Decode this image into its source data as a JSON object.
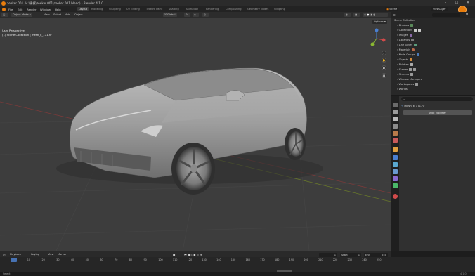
{
  "window": {
    "title": "zeeker 001 (H:\\建模\\zeeker 001\\zeeker 001.blend) - Blender 4.1.0",
    "min": "–",
    "max": "☐",
    "close": "✕"
  },
  "menu": [
    "File",
    "Edit",
    "Render",
    "Window",
    "Help"
  ],
  "workspaces": [
    "Layout",
    "Modeling",
    "Sculpting",
    "UV Editing",
    "Texture Paint",
    "Shading",
    "Animation",
    "Rendering",
    "Compositing",
    "Geometry Nodes",
    "Scripting"
  ],
  "active_workspace": "Layout",
  "scene": {
    "label": "Scene",
    "view_layer": "ViewLayer"
  },
  "viewport_header": {
    "mode": "Object Mode",
    "menus": [
      "View",
      "Select",
      "Add",
      "Object"
    ],
    "transform": "Global",
    "options": "Options"
  },
  "viewport": {
    "perspective": "User Perspective",
    "collection": "(1) Scene Collection | mesh_k_171.nr"
  },
  "outliner": {
    "items": [
      "Scene Collection",
      "Brushes",
      "Collections",
      "Images",
      "Libraries",
      "Line Styles",
      "Materials",
      "Node Groups",
      "Objects",
      "Palettes",
      "Scenes",
      "Screens",
      "Window Managers",
      "Workspaces",
      "Worlds"
    ]
  },
  "properties": {
    "search_placeholder": "",
    "object_name": "mesh_k_171.nr",
    "modifier_button": "Add Modifier"
  },
  "timeline_header": {
    "menus": [
      "Playback",
      "Keying",
      "View",
      "Marker"
    ],
    "current_frame": "1",
    "start_label": "Start",
    "start": "1",
    "end_label": "End",
    "end": "250"
  },
  "timeline_ticks": [
    "1",
    "10",
    "20",
    "30",
    "40",
    "50",
    "60",
    "70",
    "80",
    "90",
    "100",
    "110",
    "120",
    "130",
    "140",
    "150",
    "160",
    "170",
    "180",
    "190",
    "200",
    "210",
    "220",
    "230",
    "240",
    "250"
  ],
  "status": {
    "left": "Select",
    "version": "4.1.0"
  },
  "colors": {
    "accent": "#4772b3",
    "orange": "#e87d0d"
  }
}
